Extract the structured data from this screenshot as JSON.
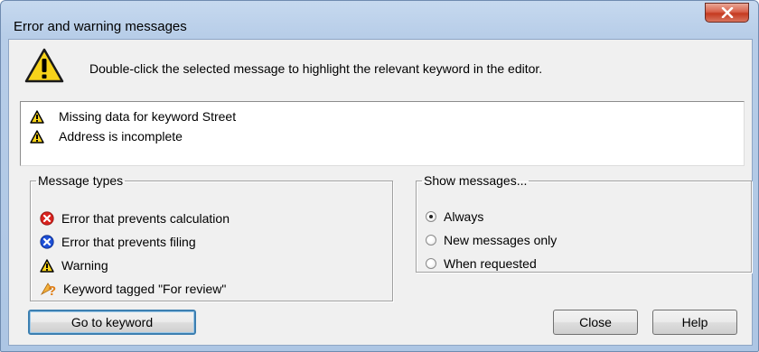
{
  "window": {
    "title": "Error and warning messages",
    "intro": "Double-click the selected message to highlight the relevant keyword in the editor."
  },
  "messages": [
    {
      "icon": "warning-icon",
      "text": "Missing data for keyword Street"
    },
    {
      "icon": "warning-icon",
      "text": "Address is incomplete"
    }
  ],
  "message_types": {
    "legend": "Message types",
    "items": [
      {
        "icon": "error-calculation-icon",
        "label": "Error that prevents calculation"
      },
      {
        "icon": "error-filing-icon",
        "label": "Error that prevents filing"
      },
      {
        "icon": "warning-icon",
        "label": "Warning"
      },
      {
        "icon": "review-tag-icon",
        "label": "Keyword tagged \"For review\""
      }
    ]
  },
  "show_messages": {
    "legend": "Show messages...",
    "options": [
      "Always",
      "New messages only",
      "When requested"
    ],
    "selected": "Always"
  },
  "buttons": {
    "goto": "Go to keyword",
    "close": "Close",
    "help": "Help"
  },
  "colors": {
    "error_red": "#d9231f",
    "error_blue": "#1d4fd6",
    "warning_yellow": "#f7d31a",
    "review_orange": "#e89a2c"
  }
}
